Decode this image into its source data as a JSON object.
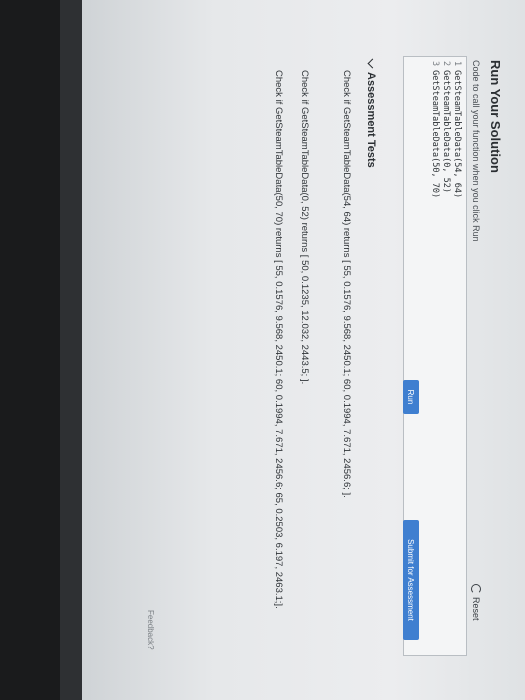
{
  "section": {
    "title": "Run Your Solution",
    "subtitle": "Code to call your function when you click Run",
    "reset_label": "Reset"
  },
  "editor": {
    "lines": [
      {
        "num": "1",
        "code": "GetSteamTableData(54, 64)"
      },
      {
        "num": "2",
        "code": "GetSteamTableData(0, 52)"
      },
      {
        "num": "3",
        "code": "GetSteamTableData(50, 70)"
      }
    ]
  },
  "buttons": {
    "run_label": "Run",
    "submit_label": "Submit for Assessment"
  },
  "assessment": {
    "header": "Assessment Tests",
    "tests": [
      "Check if GetSteamTableData(54, 64) returns [ 55, 0.1576, 9.568, 2450.1; 60, 0.1994, 7.671, 2456.6; ].",
      "Check if GetSteamTableData(0, 52) returns [ 50, 0.1235, 12.032, 2443.5; ].",
      "Check if GetSteamTableData(50, 70) returns [ 55, 0.1576, 9.568, 2450.1; 60, 0.1994, 7.671, 2456.6; 65, 0.2503, 6.197, 2463.1;]."
    ]
  },
  "footer": {
    "feedback_label": "Feedback?"
  }
}
